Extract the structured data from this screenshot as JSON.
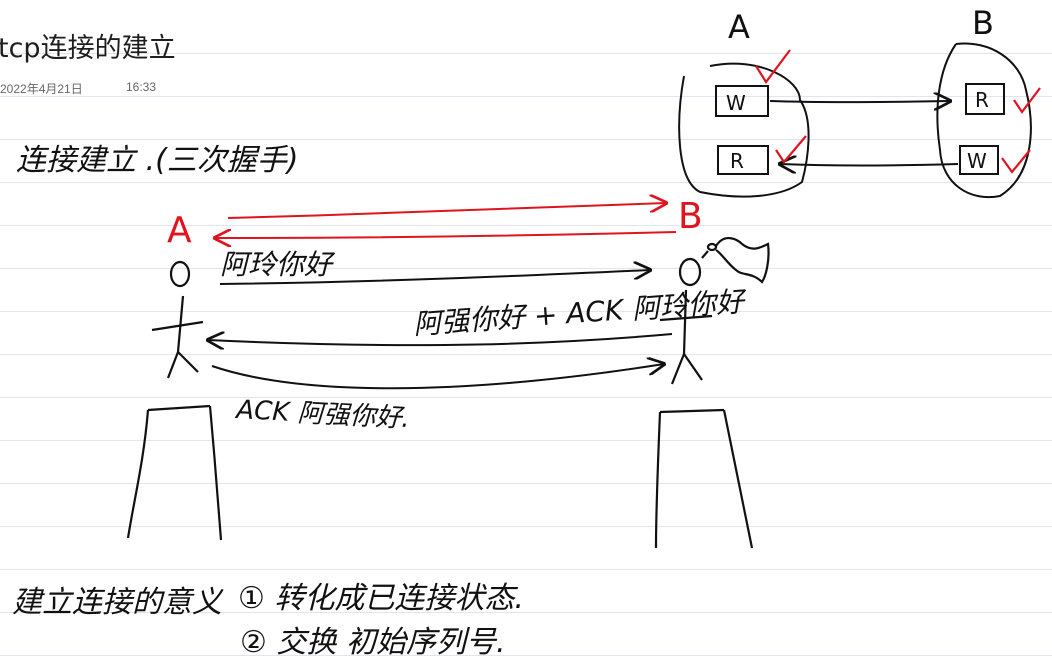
{
  "note": {
    "title": "tcp连接的建立",
    "date": "2022年4月21日",
    "time": "16:33"
  },
  "handwriting": {
    "heading": "连接建立 .(三次握手)",
    "party_a": "A",
    "party_b": "B",
    "msg1": "阿玲你好",
    "msg2": "阿强你好 + ACK 阿玲你好",
    "msg3": "ACK 阿强你好.",
    "meaning_label": "建立连接的意义",
    "meaning_1": "① 转化成已连接状态.",
    "meaning_2": "② 交换 初始序列号."
  },
  "diagram": {
    "host_a": "A",
    "host_b": "B",
    "a_write": "W",
    "a_read": "R",
    "b_read": "R",
    "b_write": "W"
  },
  "colors": {
    "ink": "#111111",
    "red_ink": "#e0141e",
    "rule_line": "#dfe6f3"
  }
}
